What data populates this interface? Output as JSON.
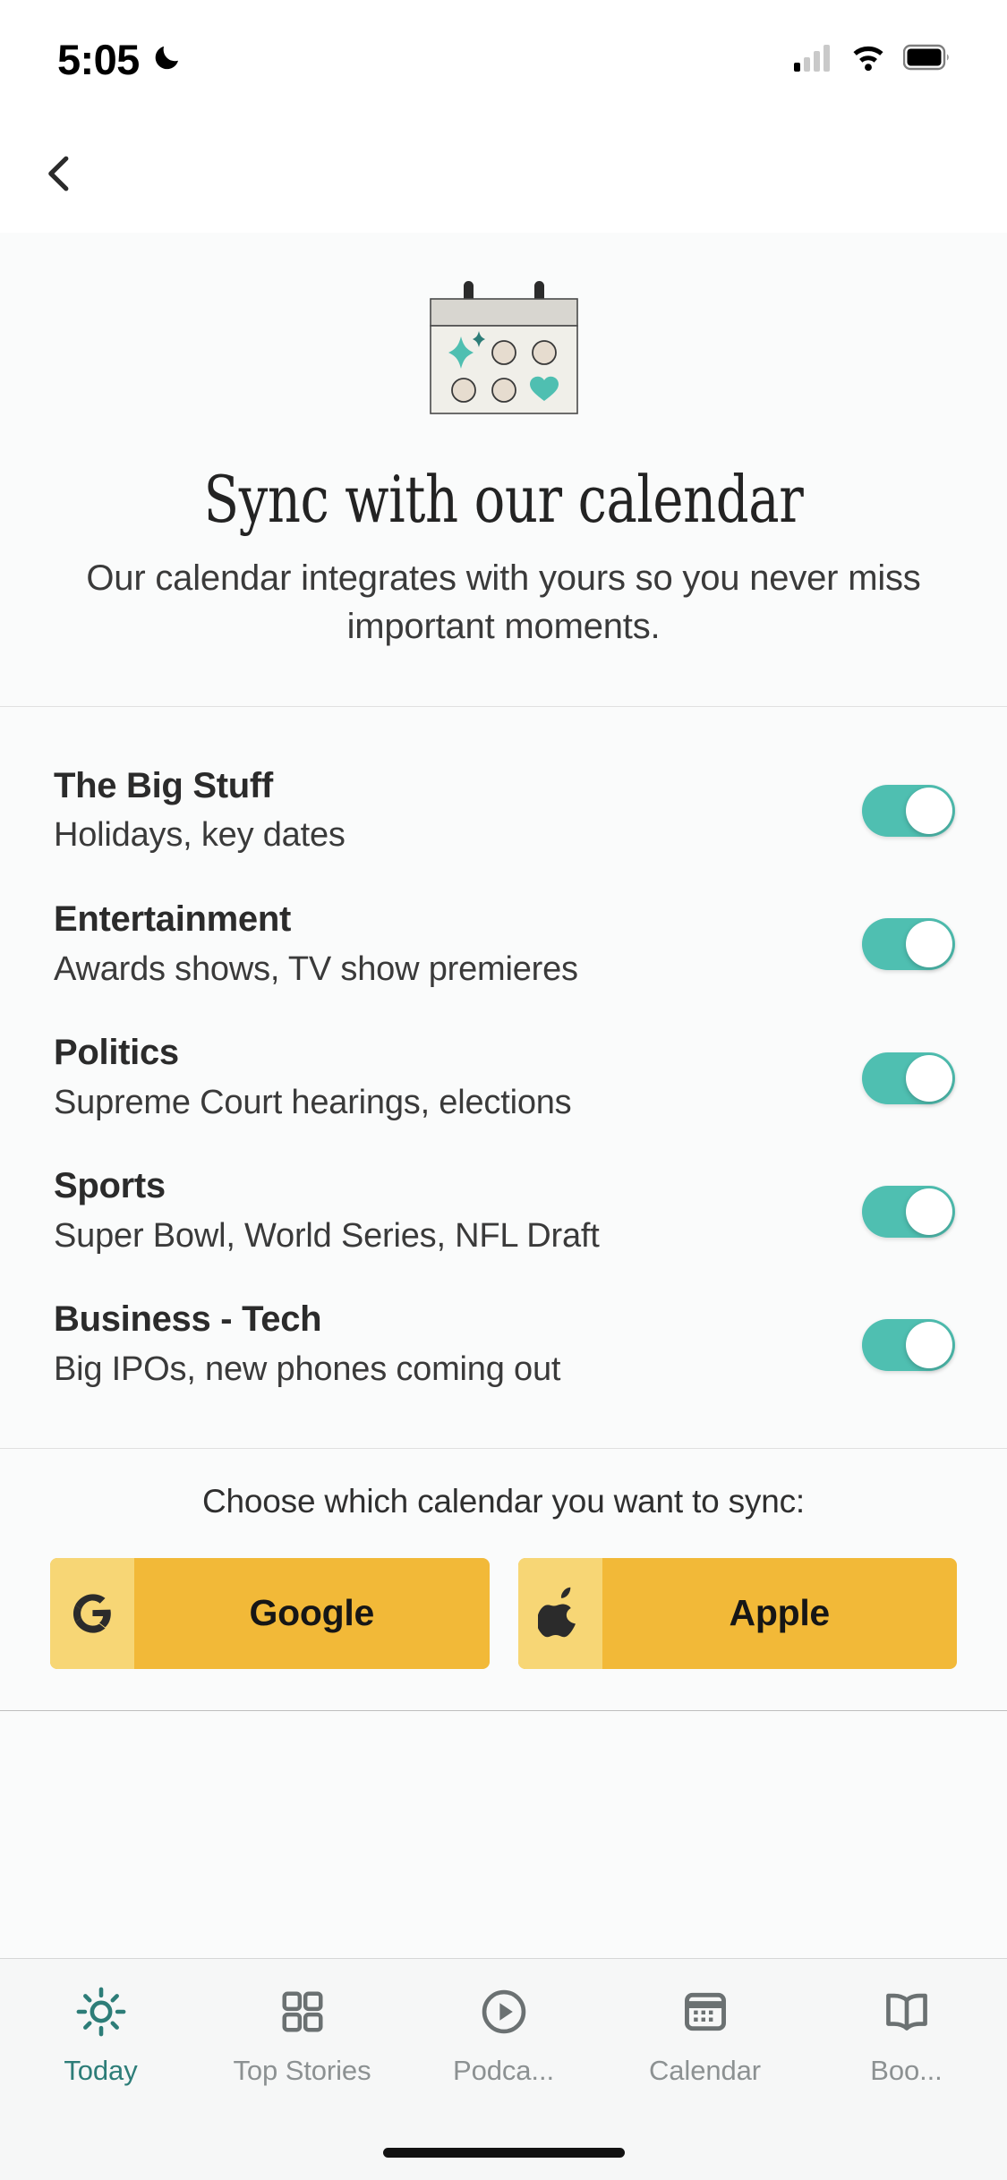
{
  "status_bar": {
    "time": "5:05",
    "dnd_icon": "crescent-moon-icon",
    "signal_icon": "cellular-signal-icon",
    "signal_bars_filled": 1,
    "signal_bars_total": 4,
    "wifi_icon": "wifi-icon",
    "battery_icon": "battery-full-icon"
  },
  "nav": {
    "back_icon": "chevron-left-icon"
  },
  "hero": {
    "illustration": "calendar-illustration",
    "title": "Sync with our calendar",
    "subtitle": "Our calendar integrates with yours so you never miss important moments."
  },
  "categories": [
    {
      "title": "The Big Stuff",
      "subtitle": "Holidays, key dates",
      "enabled": true
    },
    {
      "title": "Entertainment",
      "subtitle": "Awards shows, TV show premieres",
      "enabled": true
    },
    {
      "title": "Politics",
      "subtitle": "Supreme Court hearings, elections",
      "enabled": true
    },
    {
      "title": "Sports",
      "subtitle": "Super Bowl, World Series, NFL Draft",
      "enabled": true
    },
    {
      "title": "Business - Tech",
      "subtitle": "Big IPOs, new phones coming out",
      "enabled": true
    }
  ],
  "sync": {
    "label": "Choose which calendar you want to sync:",
    "providers": [
      {
        "name": "Google",
        "icon": "google-g-icon"
      },
      {
        "name": "Apple",
        "icon": "apple-logo-icon"
      }
    ]
  },
  "tabs": [
    {
      "label": "Today",
      "icon": "sun-icon",
      "active": true
    },
    {
      "label": "Top Stories",
      "icon": "grid-icon",
      "active": false
    },
    {
      "label": "Podca...",
      "icon": "play-circle-icon",
      "active": false
    },
    {
      "label": "Calendar",
      "icon": "calendar-icon",
      "active": false
    },
    {
      "label": "Boo...",
      "icon": "book-icon",
      "active": false
    }
  ],
  "colors": {
    "accent_teal": "#4FBFB1",
    "active_tab_teal": "#2D7D78",
    "provider_yellow": "#F2B938",
    "provider_yellow_light": "#F7D675",
    "hero_bg": "#FAFBFB"
  }
}
